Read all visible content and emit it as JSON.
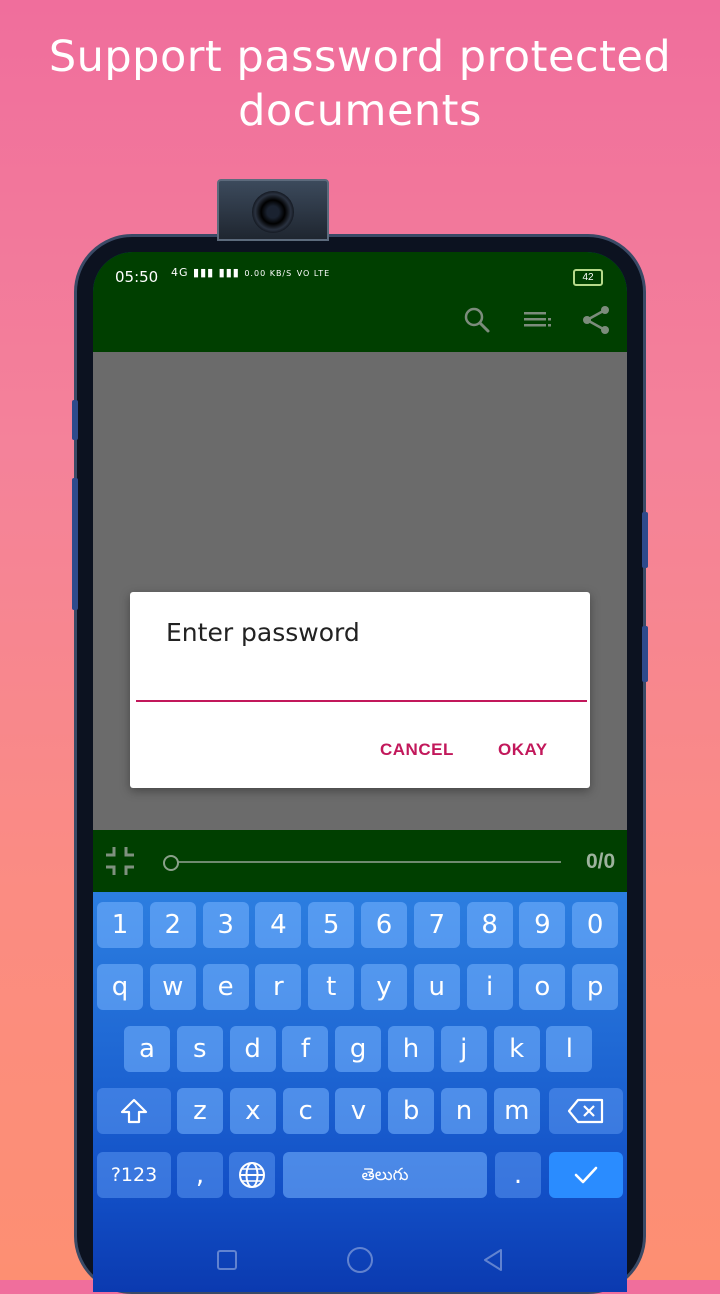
{
  "headline": {
    "line1": "Support password protected",
    "line2": "documents"
  },
  "status_bar": {
    "time": "05:50",
    "signal": "4G ▮▮▮ ▮▮▮",
    "speed": "0.00 KB/S",
    "volte": "VO LTE",
    "battery": "42"
  },
  "toolbar": {
    "icons": [
      "search-icon",
      "list-icon",
      "share-icon"
    ]
  },
  "dialog": {
    "title": "Enter password",
    "password_value": "",
    "cancel_label": "CANCEL",
    "okay_label": "OKAY",
    "accent_color": "#c2185b"
  },
  "viewer_bar": {
    "page_count": "0/0",
    "progress": 0
  },
  "keyboard": {
    "row1": [
      "1",
      "2",
      "3",
      "4",
      "5",
      "6",
      "7",
      "8",
      "9",
      "0"
    ],
    "row2": [
      "q",
      "w",
      "e",
      "r",
      "t",
      "y",
      "u",
      "i",
      "o",
      "p"
    ],
    "row3": [
      "a",
      "s",
      "d",
      "f",
      "g",
      "h",
      "j",
      "k",
      "l"
    ],
    "row4": [
      "z",
      "x",
      "c",
      "v",
      "b",
      "n",
      "m"
    ],
    "symbols_label": "?123",
    "comma_label": ",",
    "space_label": "తెలుగు",
    "period_label": "."
  },
  "colors": {
    "app_bar": "#003f00",
    "content_bg": "#6b6b6b"
  }
}
